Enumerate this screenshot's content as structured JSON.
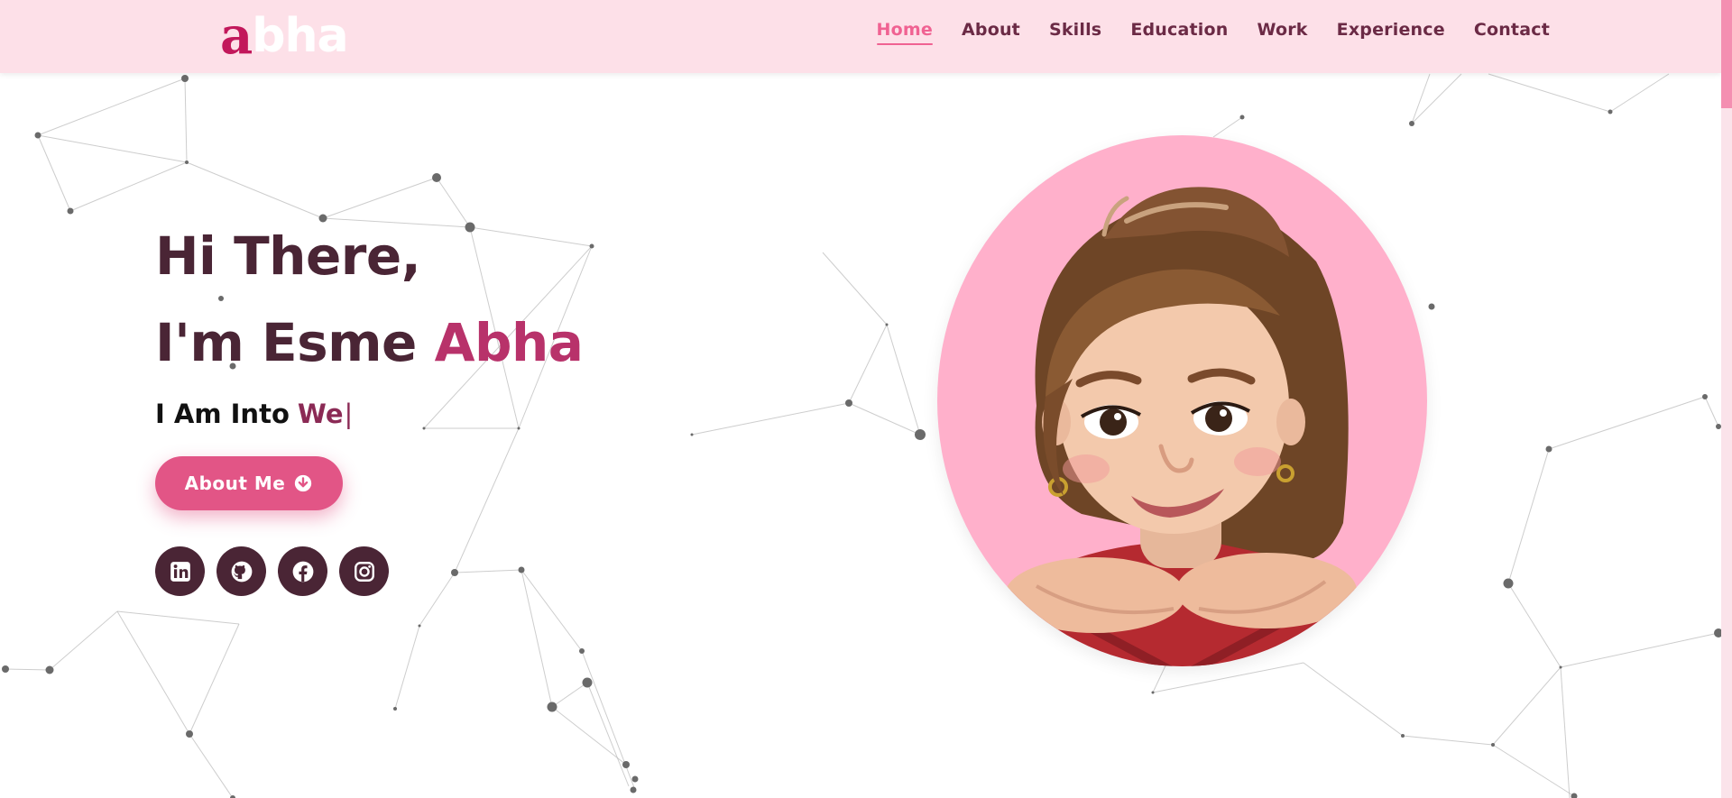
{
  "navbar": {
    "logo_first": "a",
    "logo_rest": "bha",
    "links": [
      {
        "label": "Home",
        "active": true
      },
      {
        "label": "About",
        "active": false
      },
      {
        "label": "Skills",
        "active": false
      },
      {
        "label": "Education",
        "active": false
      },
      {
        "label": "Work",
        "active": false
      },
      {
        "label": "Experience",
        "active": false
      },
      {
        "label": "Contact",
        "active": false
      }
    ]
  },
  "hero": {
    "greeting": "Hi There,",
    "intro_prefix": "I'm Esme",
    "intro_name": "Abha",
    "typing_prefix": "I Am Into",
    "typing_text": "We",
    "typing_cursor": "|",
    "about_button_label": "About Me",
    "about_button_icon": "arrow-down-circle-icon"
  },
  "socials": [
    {
      "name": "linkedin-icon"
    },
    {
      "name": "github-icon"
    },
    {
      "name": "facebook-icon"
    },
    {
      "name": "instagram-icon"
    }
  ],
  "colors": {
    "navbar_bg": "#fde0e8",
    "accent": "#f06292",
    "button": "#e25586",
    "dark": "#4a2535",
    "name_highlight": "#b8326a",
    "avatar_bg": "#ffb0cb"
  }
}
